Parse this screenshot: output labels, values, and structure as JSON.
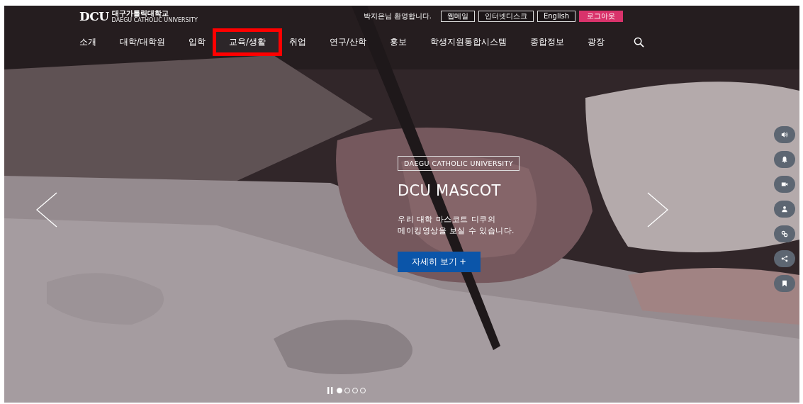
{
  "logo": {
    "mark": "DCU",
    "name": "대구가톨릭대학교",
    "subtitle": "DAEGU CATHOLIC UNIVERSITY"
  },
  "utility": {
    "welcome": "박지은님 환영합니다.",
    "links": [
      {
        "label": "웹메일",
        "kind": "outline"
      },
      {
        "label": "인터넷디스크",
        "kind": "outline"
      },
      {
        "label": "English",
        "kind": "outline"
      },
      {
        "label": "로그아웃",
        "kind": "filled"
      }
    ]
  },
  "nav": [
    {
      "label": "소개",
      "highlighted": false
    },
    {
      "label": "대학/대학원",
      "highlighted": false
    },
    {
      "label": "입학",
      "highlighted": false
    },
    {
      "label": "교육/생활",
      "highlighted": true
    },
    {
      "label": "취업",
      "highlighted": false
    },
    {
      "label": "연구/산학",
      "highlighted": false
    },
    {
      "label": "홍보",
      "highlighted": false
    },
    {
      "label": "학생지원통합시스템",
      "highlighted": false
    },
    {
      "label": "종합정보",
      "highlighted": false
    },
    {
      "label": "광장",
      "highlighted": false
    }
  ],
  "hero": {
    "tag": "DAEGU CATHOLIC UNIVERSITY",
    "title": "DCU MASCOT",
    "text": "우리 대학 마스코트 디쿠의\n메이킹영상을 보실 수 있습니다.",
    "button": "자세히 보기 +"
  },
  "side_buttons": [
    {
      "kind": "sound"
    },
    {
      "kind": "bell"
    },
    {
      "kind": "video"
    },
    {
      "kind": "person"
    },
    {
      "kind": "link"
    },
    {
      "kind": "share"
    },
    {
      "kind": "bookmark"
    }
  ],
  "slides": [
    {
      "selected": true
    },
    {
      "selected": false
    },
    {
      "selected": false
    },
    {
      "selected": false
    }
  ]
}
